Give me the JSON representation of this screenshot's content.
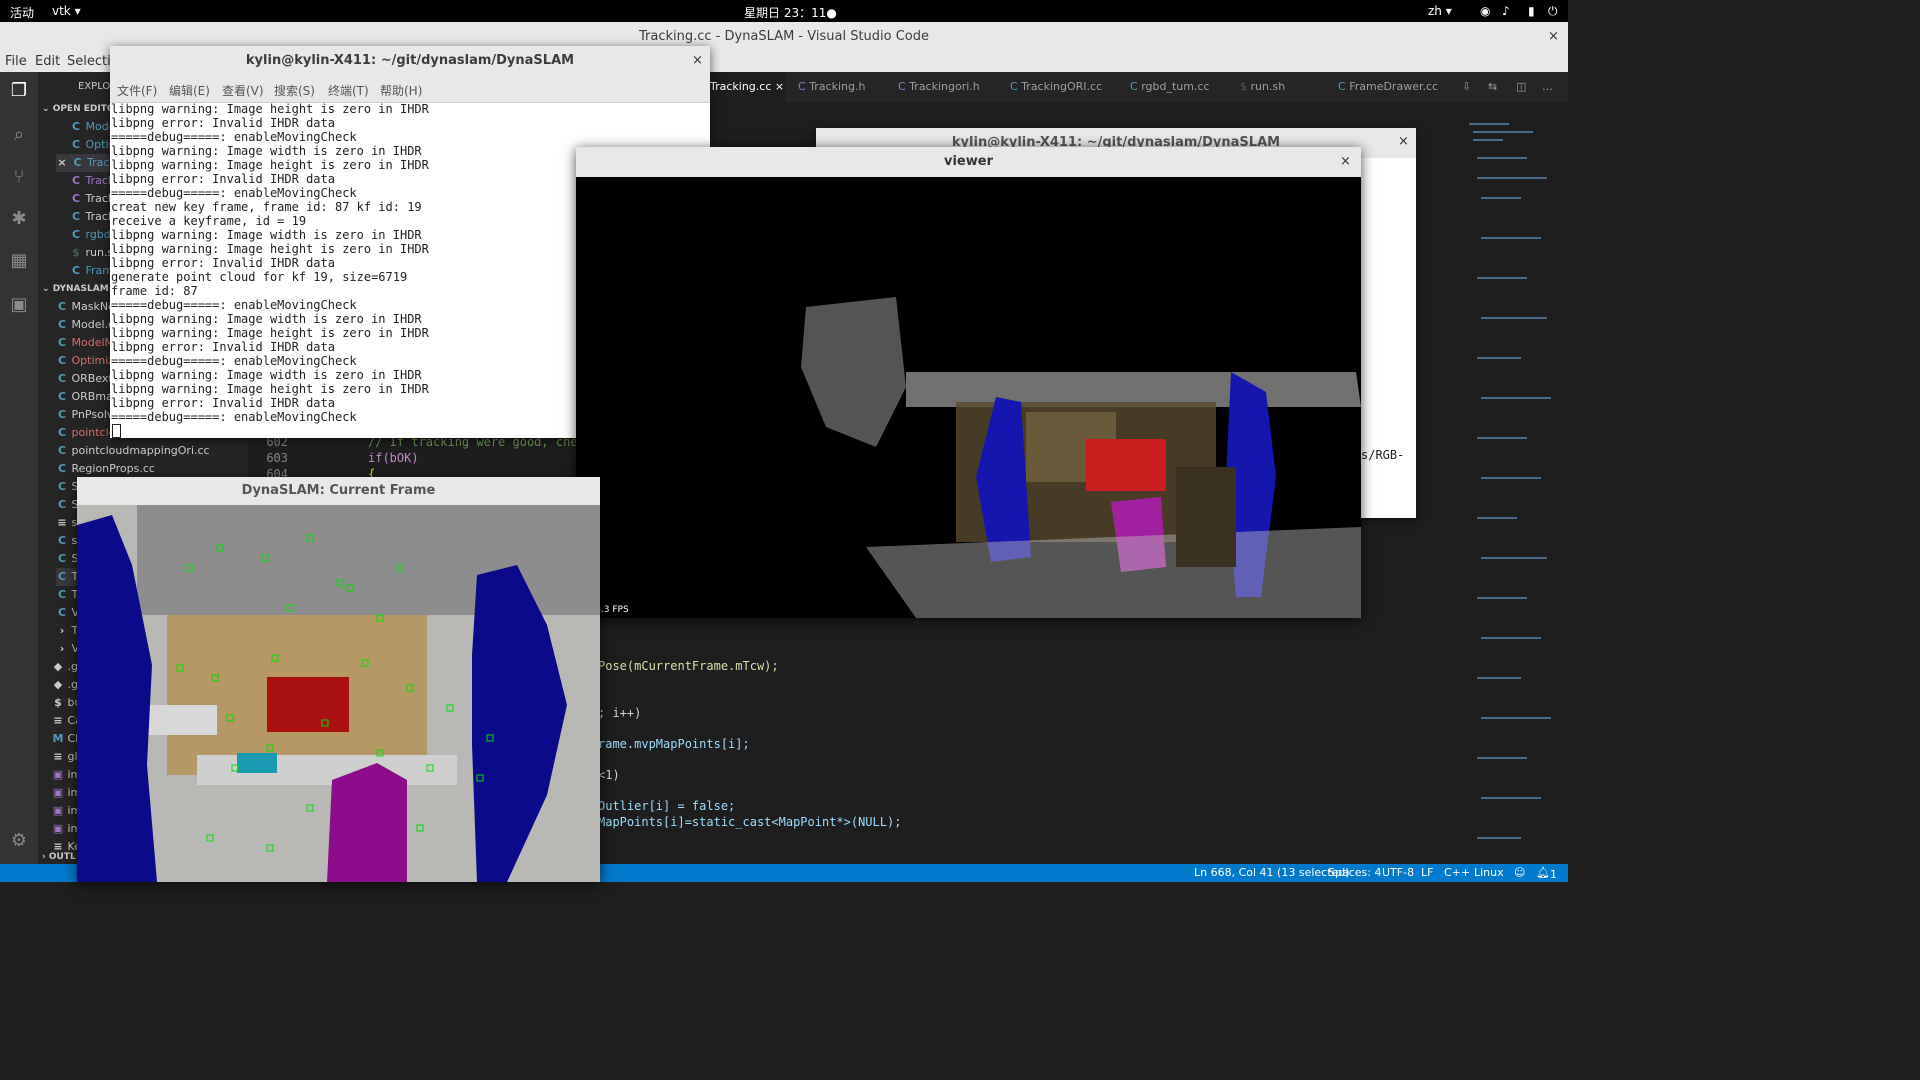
{
  "topbar": {
    "activities": "活动",
    "app": "vtk ▾",
    "clock": "星期日 23：11●",
    "lang": "zh ▾"
  },
  "vscode": {
    "title": "Tracking.cc - DynaSLAM - Visual Studio Code",
    "menu": [
      "File",
      "Edit",
      "Selectio"
    ],
    "explorer_label": "EXPLORER",
    "open_editors_label": "OPEN EDITO",
    "open_editors": [
      "Mode",
      "Optin",
      "Track",
      "Track",
      "Track",
      "Track",
      "rgbd",
      "run.s",
      "Fram"
    ],
    "project_label": "DYNASLAM",
    "files": [
      "MaskNe",
      "Model.c",
      "ModelM",
      "Optimiz",
      "ORBext",
      "ORBma",
      "PnPsolv",
      "pointclo",
      "pointcloudmappingOri.cc",
      "RegionProps.cc",
      "S",
      "S",
      "s",
      "s",
      "S",
      "T",
      "T",
      "V"
    ],
    "folders": [
      "Th",
      "Vc",
      ".gi",
      ".gi",
      "bu",
      "Ca",
      "CN",
      "gl",
      "im",
      "im",
      "im",
      "im",
      "Ke"
    ],
    "outline_label": "OUTL",
    "tabs": [
      "Tracking.cc",
      "Tracking.h",
      "Trackingori.h",
      "TrackingORI.cc",
      "rgbd_tum.cc",
      "run.sh",
      "FrameDrawer.cc"
    ],
    "line_numbers": [
      "602",
      "603",
      "604"
    ],
    "code_lines": [
      "// If tracking were good, chec",
      "if(bOK)",
      "{"
    ],
    "code_right": [
      "Pose(mCurrentFrame.mTcw);",
      "; i++)",
      "rame.mvpMapPoints[i];",
      "<1)",
      "Outlier[i] = false;",
      "MapPoints[i]=static_cast<MapPoint*>(NULL);"
    ],
    "status": {
      "position": "Ln 668, Col 41 (13 selected)",
      "spaces": "Spaces: 4",
      "encoding": "UTF-8",
      "eol": "LF",
      "lang": "C++",
      "os": "Linux",
      "notif": "1"
    },
    "peek_text": "s/RGB-"
  },
  "terminal": {
    "title": "kylin@kylin-X411: ~/git/dynaslam/DynaSLAM",
    "menu": [
      "文件(F)",
      "编辑(E)",
      "查看(V)",
      "搜索(S)",
      "终端(T)",
      "帮助(H)"
    ],
    "lines": [
      "libpng warning: Image height is zero in IHDR",
      "libpng error: Invalid IHDR data",
      "=====debug=====: enableMovingCheck",
      "libpng warning: Image width is zero in IHDR",
      "libpng warning: Image height is zero in IHDR",
      "libpng error: Invalid IHDR data",
      "=====debug=====: enableMovingCheck",
      "creat new key frame, frame id: 87 kf id: 19",
      "receive a keyframe, id = 19",
      "libpng warning: Image width is zero in IHDR",
      "libpng warning: Image height is zero in IHDR",
      "libpng error: Invalid IHDR data",
      "generate point cloud for kf 19, size=6719",
      "frame id: 87",
      "=====debug=====: enableMovingCheck",
      "libpng warning: Image width is zero in IHDR",
      "libpng warning: Image height is zero in IHDR",
      "libpng error: Invalid IHDR data",
      "=====debug=====: enableMovingCheck",
      "libpng warning: Image width is zero in IHDR",
      "libpng warning: Image height is zero in IHDR",
      "libpng error: Invalid IHDR data",
      "=====debug=====: enableMovingCheck"
    ]
  },
  "back_terminal": {
    "title": "kylin@kylin-X411: ~/git/dynaslam/DynaSLAM"
  },
  "viewer": {
    "title": "viewer",
    "fps": "1453.3 FPS"
  },
  "frame": {
    "title": "DynaSLAM: Current Frame"
  }
}
